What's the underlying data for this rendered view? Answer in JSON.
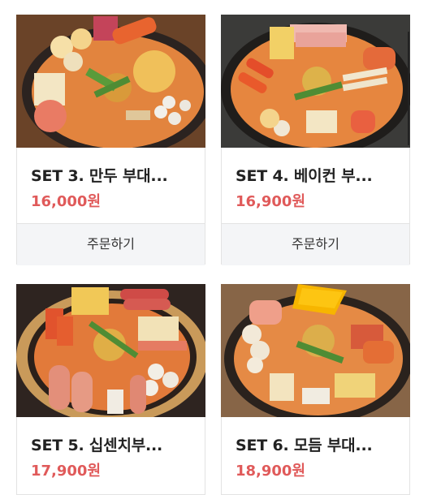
{
  "products": [
    {
      "title": "SET 3. 만두 부대...",
      "price": "16,000원",
      "order_label": "주문하기"
    },
    {
      "title": "SET 4. 베이컨 부...",
      "price": "16,900원",
      "order_label": "주문하기"
    },
    {
      "title": "SET 5. 십센치부...",
      "price": "17,900원"
    },
    {
      "title": "SET 6. 모듬 부대...",
      "price": "18,900원"
    }
  ],
  "colors": {
    "price": "#e05a5a",
    "button_bg": "#f4f5f7",
    "border": "#e3e3e3"
  }
}
